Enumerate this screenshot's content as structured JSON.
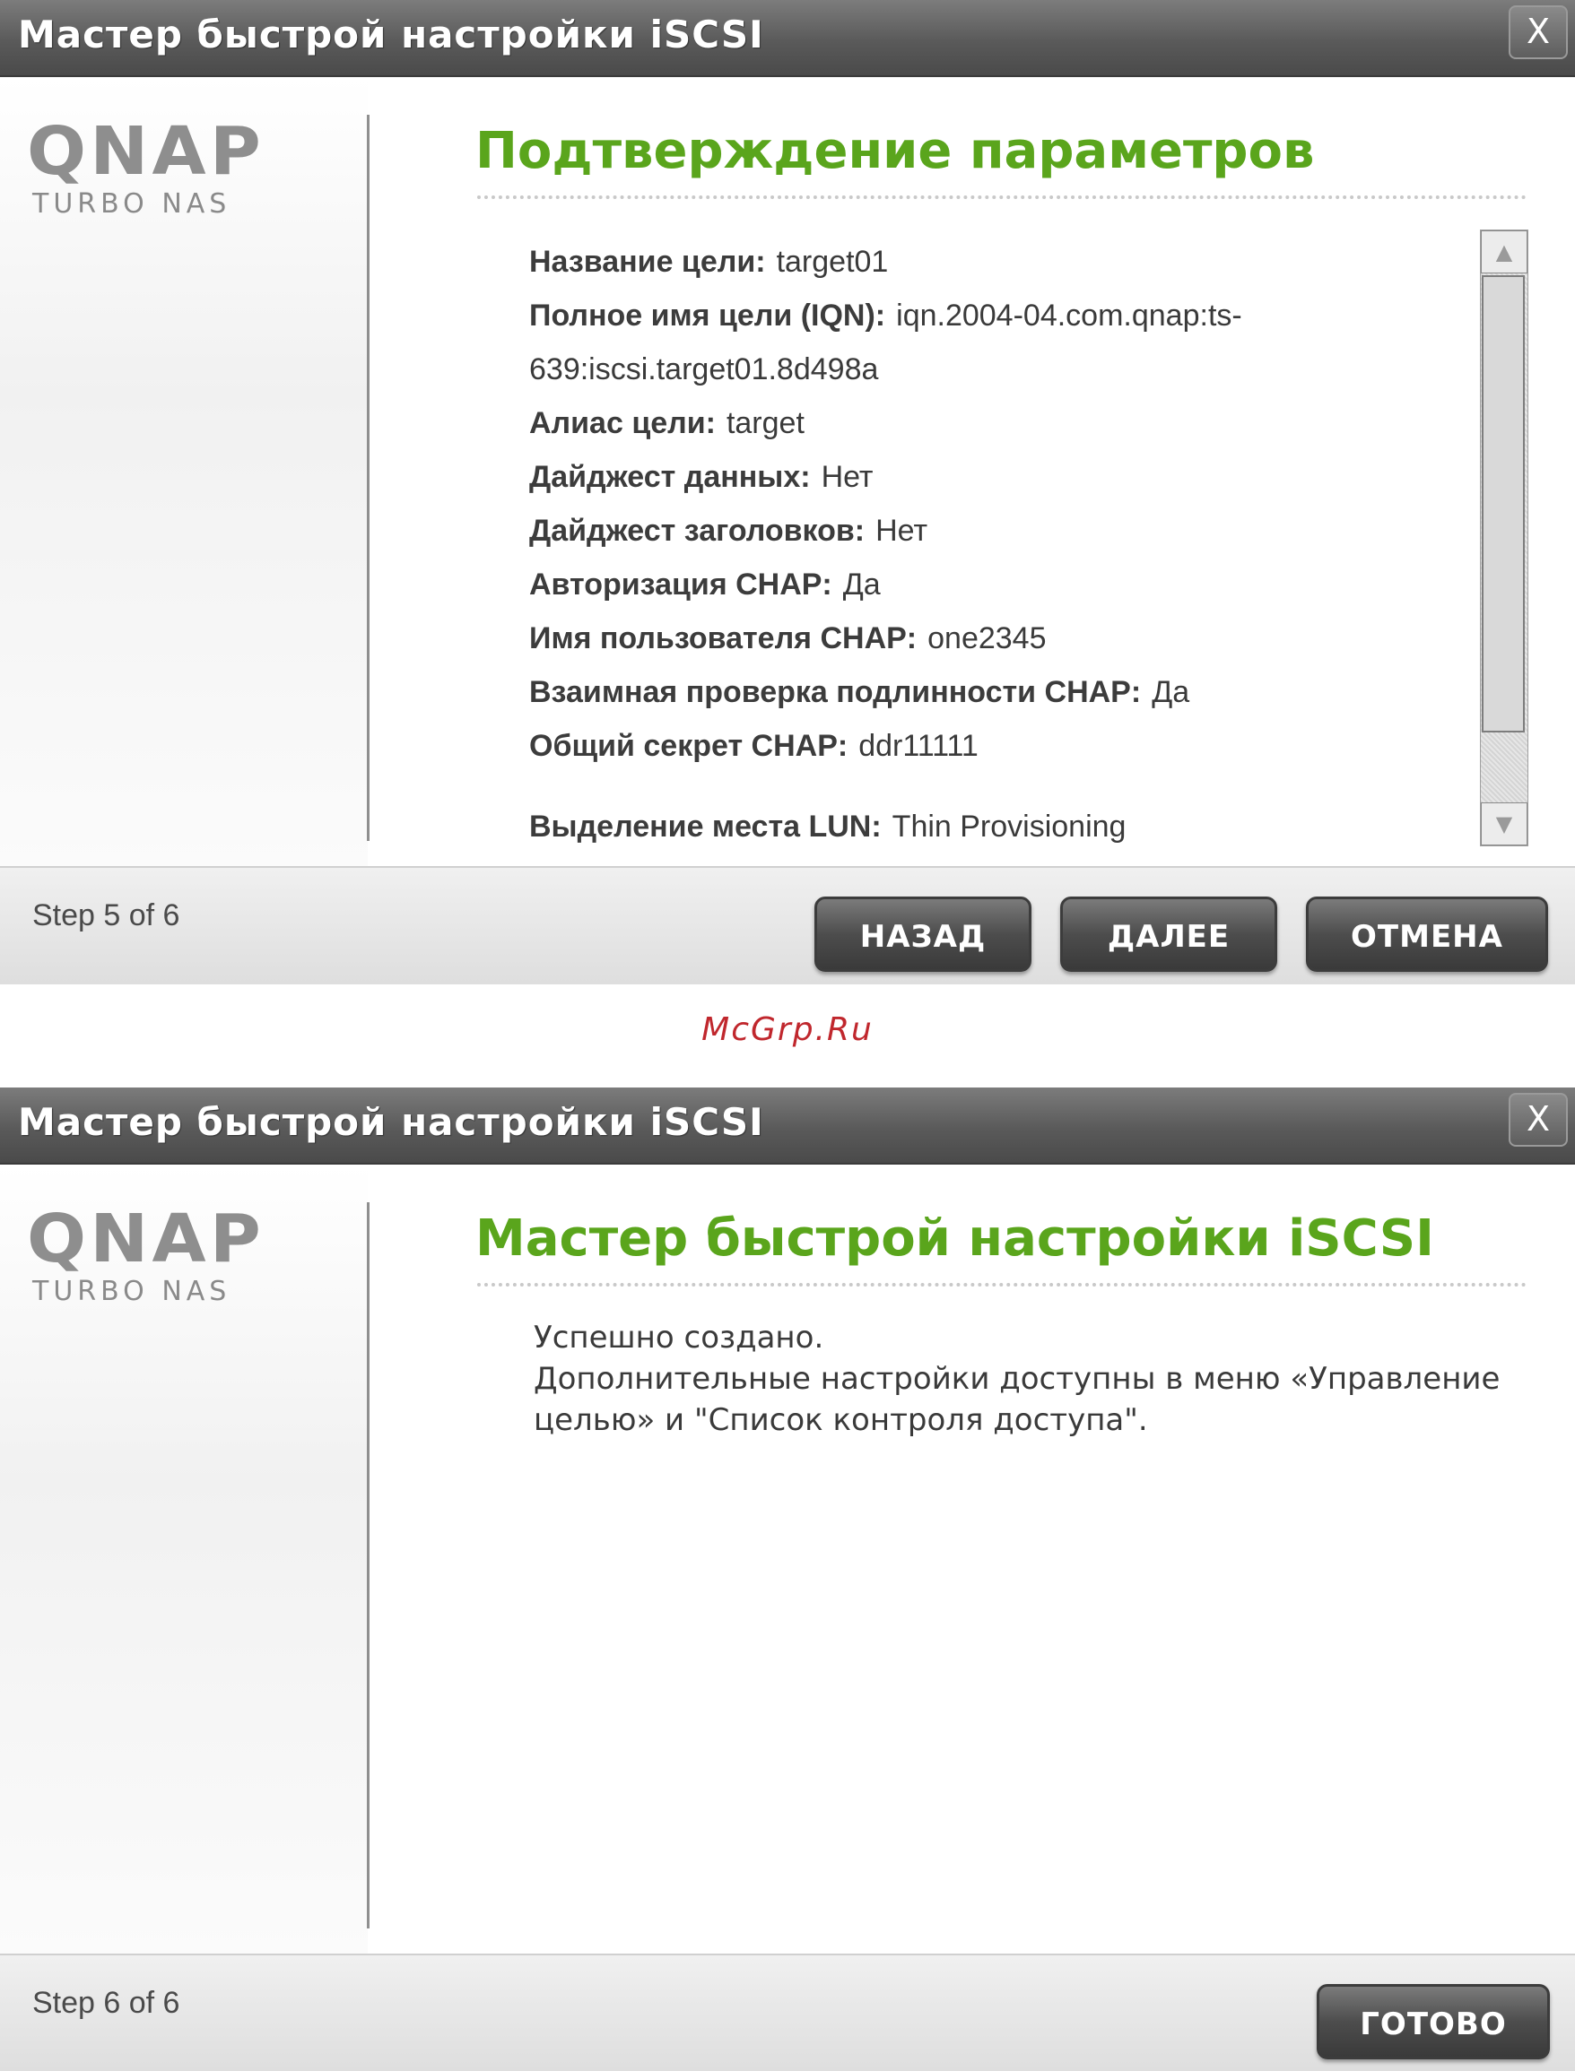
{
  "dialog1": {
    "title": "Мастер быстрой настройки iSCSI",
    "close_label": "X",
    "logo": {
      "main": "QNAP",
      "sub": "TURBO NAS"
    },
    "heading": "Подтверждение параметров",
    "params": [
      {
        "label": "Название цели:",
        "value": "target01"
      },
      {
        "label": "Полное имя цели (IQN):",
        "value": "iqn.2004-04.com.qnap:ts-"
      },
      {
        "label": "",
        "value": "639:iscsi.target01.8d498a"
      },
      {
        "label": "Алиас цели:",
        "value": "target"
      },
      {
        "label": "Дайджест данных:",
        "value": "Нет"
      },
      {
        "label": "Дайджест заголовков:",
        "value": "Нет"
      },
      {
        "label": "Авторизация CHAP:",
        "value": "Да"
      },
      {
        "label": "Имя пользователя CHAP:",
        "value": "one2345"
      },
      {
        "label": "Взаимная проверка подлинности CHAP:",
        "value": "Да"
      },
      {
        "label": "Общий секрет CHAP:",
        "value": "ddr11111"
      },
      {
        "label": "Выделение места LUN:",
        "value": "Thin Provisioning"
      }
    ],
    "step": "Step 5 of 6",
    "buttons": {
      "back": "НАЗАД",
      "next": "ДАЛЕЕ",
      "cancel": "ОТМЕНА"
    }
  },
  "watermark": "McGrp.Ru",
  "dialog2": {
    "title": "Мастер быстрой настройки iSCSI",
    "close_label": "X",
    "logo": {
      "main": "QNAP",
      "sub": "TURBO NAS"
    },
    "heading": "Мастер быстрой настройки iSCSI",
    "message_lines": [
      "Успешно создано.",
      "Дополнительные настройки доступны в меню «Управление целью» и \"Список контроля доступа\"."
    ],
    "step": "Step 6 of 6",
    "buttons": {
      "done": "ГОТОВО"
    }
  }
}
